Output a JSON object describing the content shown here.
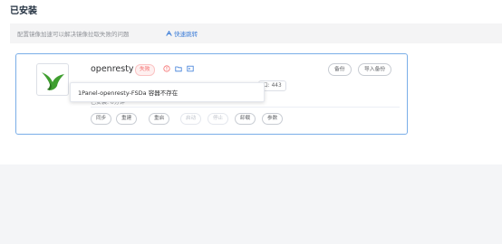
{
  "page": {
    "title": "已安装"
  },
  "notice": {
    "text": "配置镜像加速可以解决镜像拉取失败的问题",
    "link_label": "快速跳转"
  },
  "app": {
    "name": "openresty",
    "status": "失败",
    "port_text": "口: 443",
    "installed_text": "已安装: 0分钟",
    "tooltip": "1Panel-openresty-FSDa 容器不存在",
    "top_buttons": [
      "备份",
      "导入备份"
    ],
    "actions": [
      {
        "label": "同步",
        "disabled": false
      },
      {
        "label": "重建",
        "disabled": false
      },
      {
        "label": "重启",
        "disabled": false
      },
      {
        "label": "启动",
        "disabled": true
      },
      {
        "label": "停止",
        "disabled": true
      },
      {
        "label": "卸载",
        "disabled": false
      },
      {
        "label": "参数",
        "disabled": false
      }
    ]
  },
  "colors": {
    "accent": "#3c7dd8",
    "error": "#f56c6c",
    "logo_green": "#3e9e2f"
  },
  "icons": [
    "info-circle-icon",
    "folder-icon",
    "terminal-icon",
    "link-icon",
    "app-logo-icon"
  ]
}
